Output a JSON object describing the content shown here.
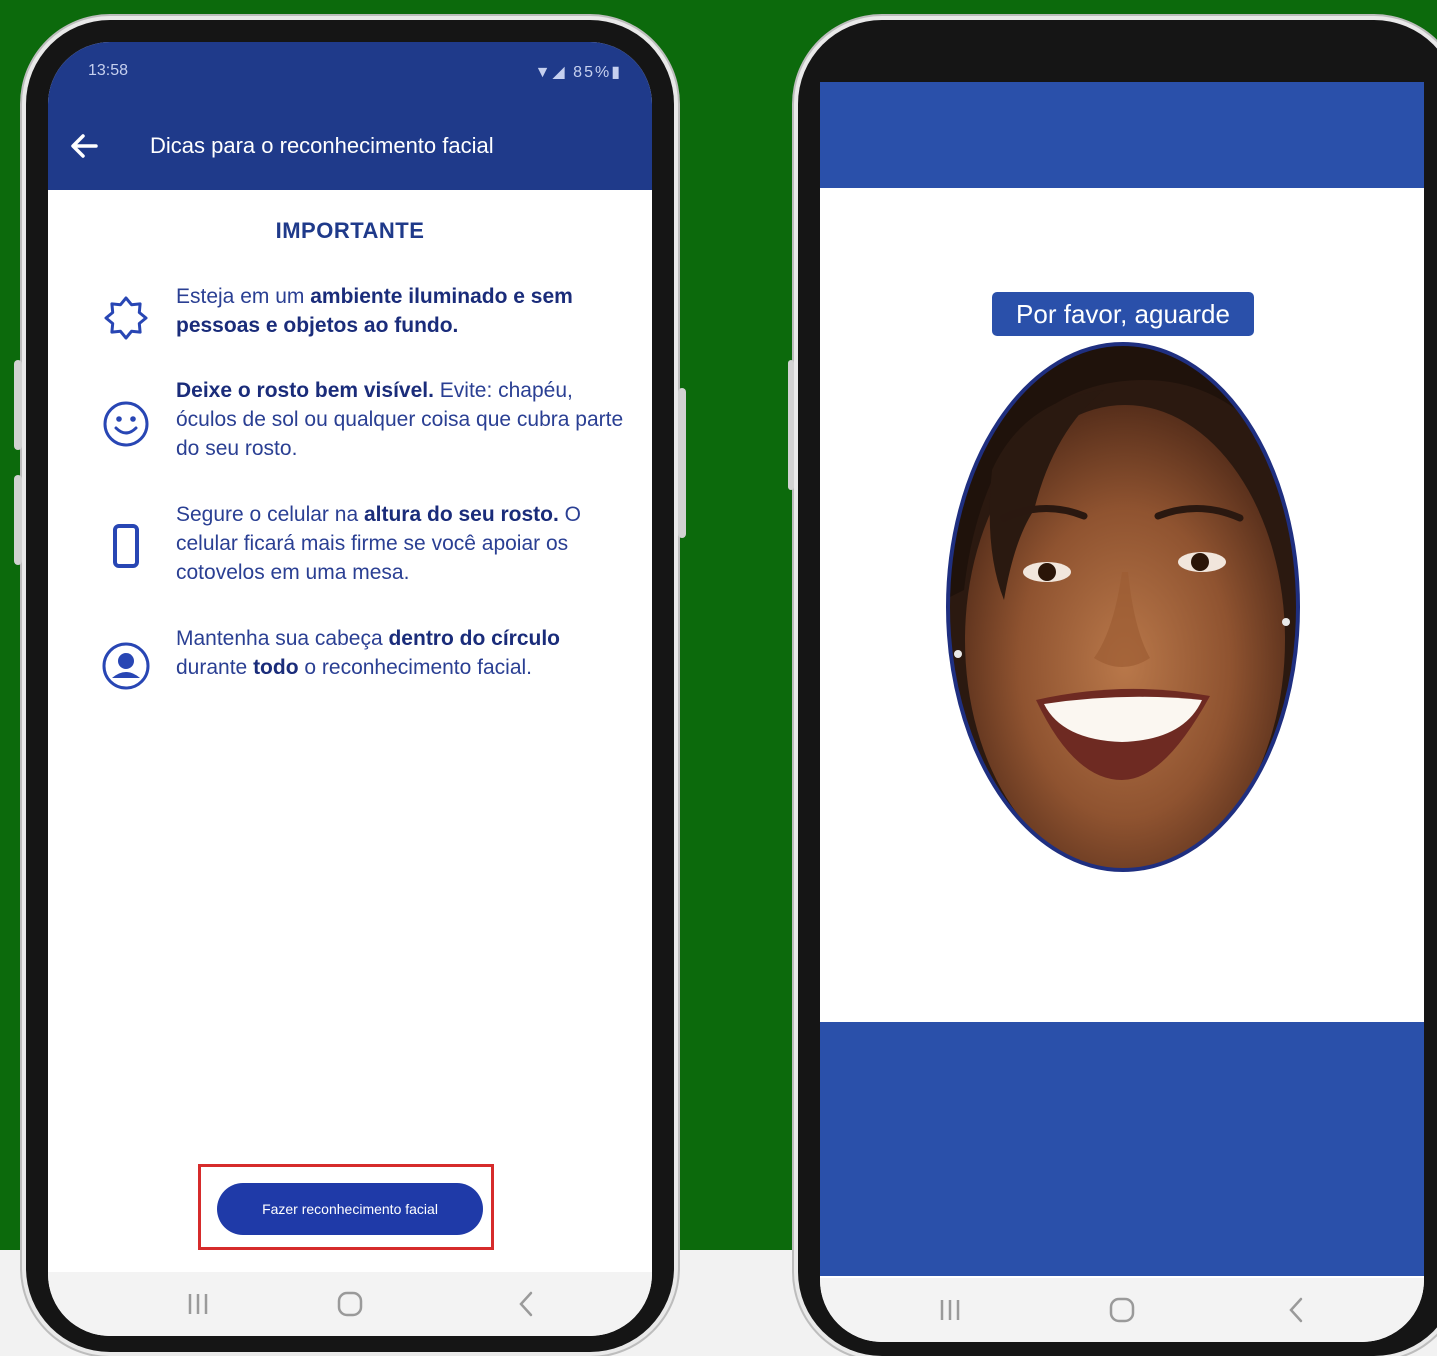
{
  "colors": {
    "background_green": "#0c6a0c",
    "brand_blue": "#1f3a8a",
    "loading_blue": "#2a50aa",
    "highlight_red": "#d62b2b"
  },
  "screen1": {
    "status": {
      "time": "13:58",
      "icons": "▼◢ 85%▮"
    },
    "app_bar": {
      "back_icon": "arrow-left-icon",
      "title": "Dicas para o reconhecimento facial"
    },
    "heading": "IMPORTANTE",
    "tips": [
      {
        "icon": "sun-icon",
        "text_1": "Esteja em um ",
        "bold_1": "ambiente iluminado e sem pessoas e objetos ao fundo.",
        "text_2": "",
        "bold_2": "",
        "text_3": ""
      },
      {
        "icon": "smiley-face-icon",
        "text_1": "",
        "bold_1": "Deixe o rosto bem visível.",
        "text_2": " Evite: chapéu, óculos de sol ou qualquer coisa que cubra parte do seu rosto.",
        "bold_2": "",
        "text_3": ""
      },
      {
        "icon": "smartphone-icon",
        "text_1": "Segure o celular na ",
        "bold_1": "altura do seu rosto.",
        "text_2": " O celular ficará mais firme se você apoiar os cotovelos em uma mesa.",
        "bold_2": "",
        "text_3": ""
      },
      {
        "icon": "face-circle-icon",
        "text_1": "Mantenha sua cabeça ",
        "bold_1": "dentro do círculo",
        "text_2": " durante ",
        "bold_2": "todo",
        "text_3": " o reconhecimento facial."
      }
    ],
    "cta_button": "Fazer reconhecimento facial",
    "nav": {
      "recent": "recent-apps-icon",
      "home": "home-icon",
      "back": "back-chevron-icon"
    }
  },
  "screen2": {
    "wait_label": "Por favor, aguarde",
    "face_image": "smiling-woman-face-photo",
    "nav": {
      "recent": "recent-apps-icon",
      "home": "home-icon",
      "back": "back-chevron-icon"
    }
  }
}
